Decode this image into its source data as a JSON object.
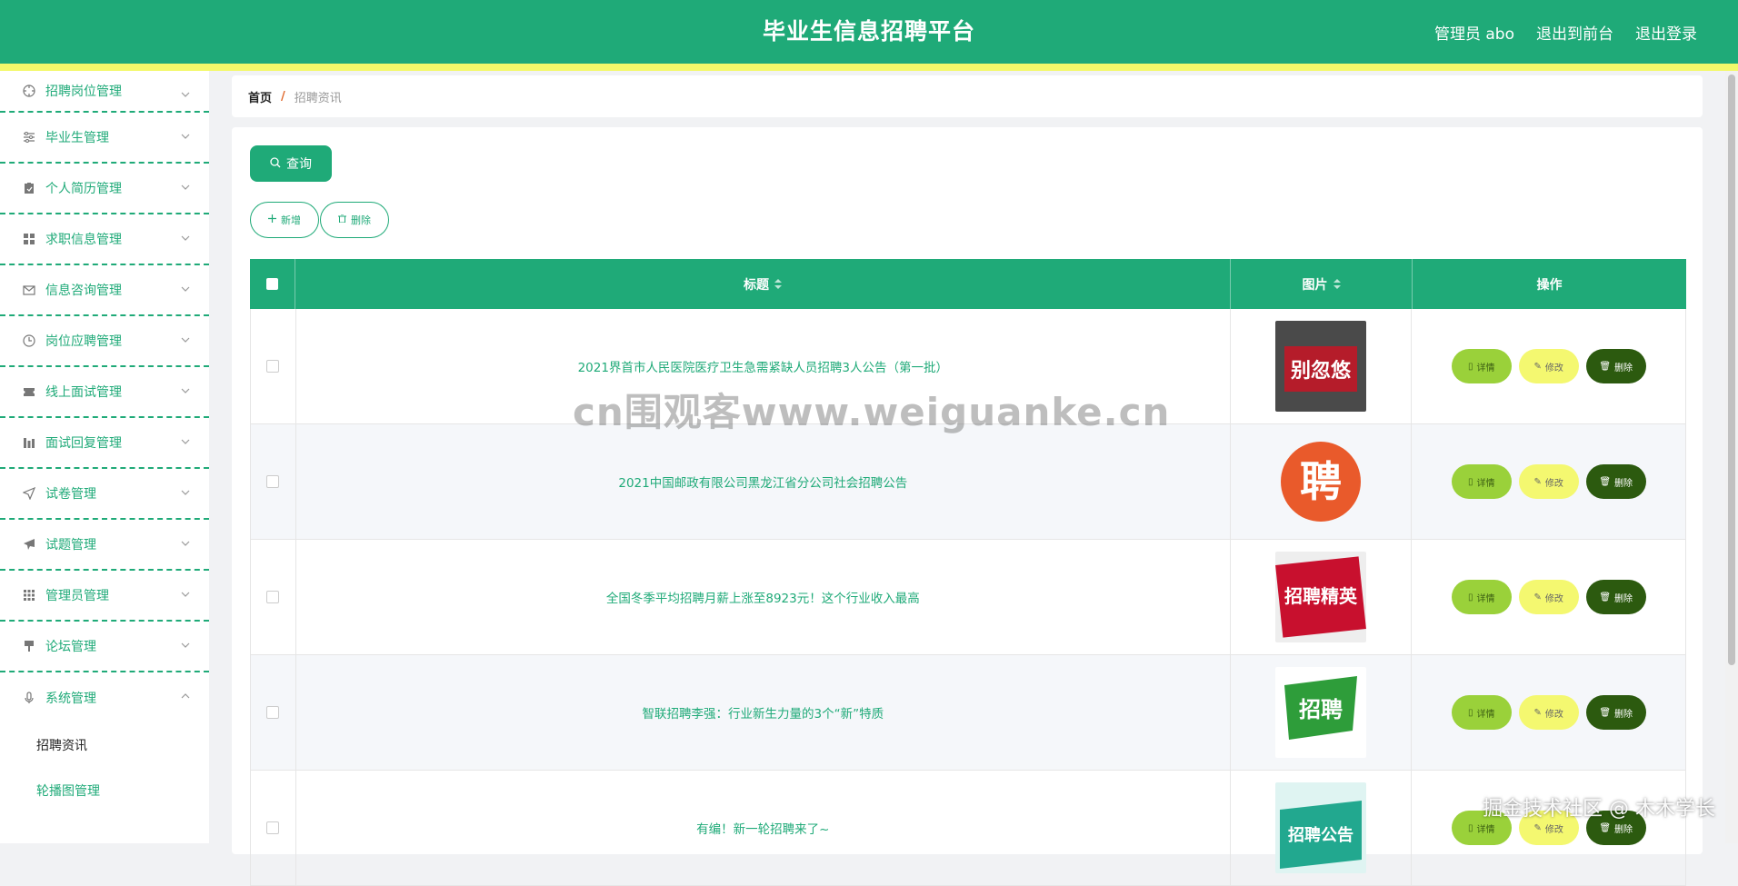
{
  "header": {
    "title": "毕业生信息招聘平台",
    "user": "管理员 abo",
    "to_front": "退出到前台",
    "logout": "退出登录"
  },
  "sidebar": {
    "items": [
      {
        "label": "招聘岗位管理",
        "icon": "compass-icon"
      },
      {
        "label": "毕业生管理",
        "icon": "sliders-icon"
      },
      {
        "label": "个人简历管理",
        "icon": "clipboard-icon"
      },
      {
        "label": "求职信息管理",
        "icon": "grid-icon"
      },
      {
        "label": "信息咨询管理",
        "icon": "mail-icon"
      },
      {
        "label": "岗位应聘管理",
        "icon": "clock-icon"
      },
      {
        "label": "线上面试管理",
        "icon": "ticket-icon"
      },
      {
        "label": "面试回复管理",
        "icon": "bar-chart-icon"
      },
      {
        "label": "试卷管理",
        "icon": "navigation-icon"
      },
      {
        "label": "试题管理",
        "icon": "send-icon"
      },
      {
        "label": "管理员管理",
        "icon": "apps-icon"
      },
      {
        "label": "论坛管理",
        "icon": "brush-icon"
      },
      {
        "label": "系统管理",
        "icon": "microphone-icon"
      }
    ],
    "sub_items": [
      "招聘资讯",
      "轮播图管理"
    ]
  },
  "breadcrumb": {
    "home": "首页",
    "sep": "/",
    "current": "招聘资讯"
  },
  "toolbar": {
    "search": "查询",
    "add": "新增",
    "delete": "删除"
  },
  "table": {
    "headers": {
      "title": "标题",
      "image": "图片",
      "ops": "操作"
    },
    "rows": [
      {
        "title": "2021界首市人民医院医疗卫生急需紧缺人员招聘3人公告（第一批）",
        "thumb_text": "别忽悠"
      },
      {
        "title": "2021中国邮政有限公司黑龙江省分公司社会招聘公告",
        "thumb_text": "聘"
      },
      {
        "title": "全国冬季平均招聘月薪上涨至8923元！这个行业收入最高",
        "thumb_text": "招聘精英"
      },
      {
        "title": "智联招聘李强：行业新生力量的3个“新”特质",
        "thumb_text": "招聘"
      },
      {
        "title": "有编！新一轮招聘来了~",
        "thumb_text": "招聘公告"
      }
    ],
    "ops": {
      "detail": "详情",
      "edit": "修改",
      "delete": "删除"
    }
  },
  "watermark": {
    "center": "cn围观客www.weiguanke.cn",
    "corner": "掘金技术社区 @ 木木学长"
  },
  "colors": {
    "primary": "#1faa78",
    "stripe": "#f3f96a",
    "detail": "#9ad13a",
    "edit": "#f4f870",
    "danger": "#2c5a0f"
  }
}
